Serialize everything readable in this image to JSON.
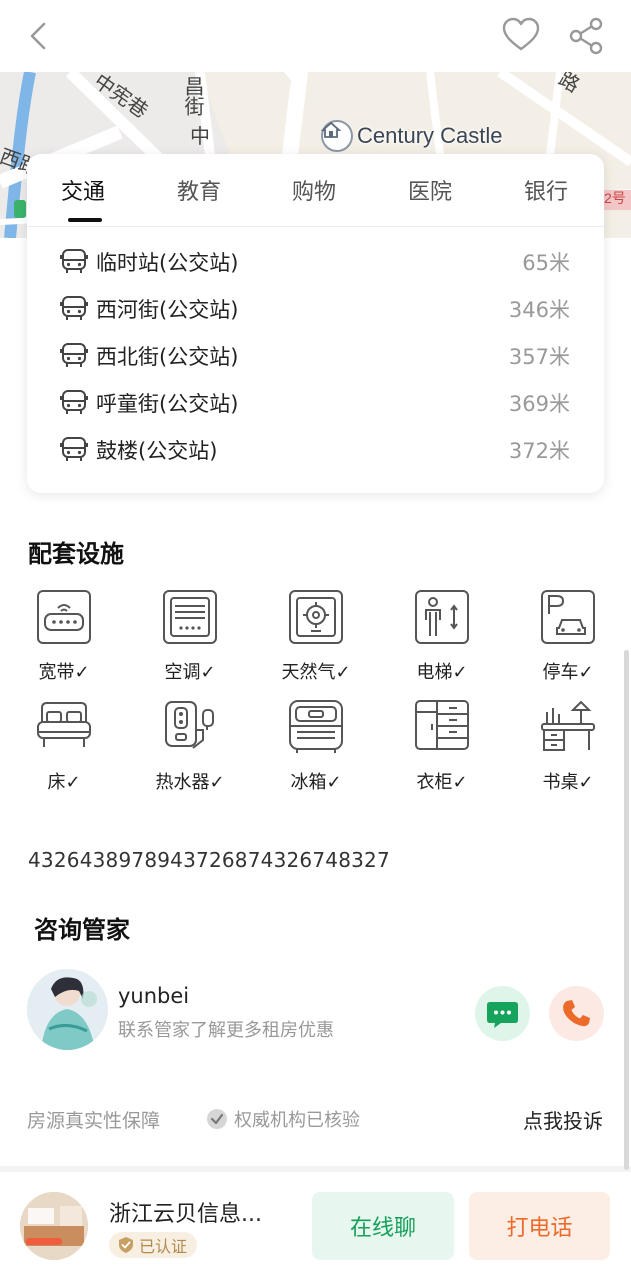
{
  "header": {
    "back_icon": "chevron-left-icon",
    "favorite_icon": "heart-outline-icon",
    "share_icon": "share-icon"
  },
  "map": {
    "labels": [
      "中宪巷",
      "昌街",
      "中",
      "西路",
      "路",
      "2号"
    ],
    "poi_name": "Century Castle",
    "poi_icon": "home-pin-icon"
  },
  "nearby": {
    "tabs": [
      "交通",
      "教育",
      "购物",
      "医院",
      "银行"
    ],
    "active_tab": "交通",
    "stops": [
      {
        "name": "临时站(公交站)",
        "distance": "65米"
      },
      {
        "name": "西河街(公交站)",
        "distance": "346米"
      },
      {
        "name": "西北街(公交站)",
        "distance": "357米"
      },
      {
        "name": "呼童街(公交站)",
        "distance": "369米"
      },
      {
        "name": "鼓楼(公交站)",
        "distance": "372米"
      }
    ]
  },
  "facilities": {
    "title": "配套设施",
    "items": [
      {
        "label": "宽带✓",
        "icon": "router-icon"
      },
      {
        "label": "空调✓",
        "icon": "air-conditioner-icon"
      },
      {
        "label": "天然气✓",
        "icon": "gas-icon"
      },
      {
        "label": "电梯✓",
        "icon": "elevator-icon"
      },
      {
        "label": "停车✓",
        "icon": "parking-icon"
      },
      {
        "label": "床✓",
        "icon": "bed-icon"
      },
      {
        "label": "热水器✓",
        "icon": "water-heater-icon"
      },
      {
        "label": "冰箱✓",
        "icon": "fridge-icon"
      },
      {
        "label": "衣柜✓",
        "icon": "wardrobe-icon"
      },
      {
        "label": "书桌✓",
        "icon": "desk-icon"
      }
    ]
  },
  "description": "4326438978943726874326748327",
  "agent": {
    "section_title": "咨询管家",
    "name": "yunbei",
    "subtitle": "联系管家了解更多租房优惠",
    "chat_icon": "chat-bubble-icon",
    "phone_icon": "phone-icon"
  },
  "guarantee": {
    "label": "房源真实性保障",
    "verified": "权威机构已核验",
    "complaint": "点我投诉"
  },
  "bottom": {
    "company": "浙江云贝信息...",
    "cert_badge": "已认证",
    "chat_button": "在线聊",
    "call_button": "打电话"
  },
  "colors": {
    "green": "#15a05a",
    "orange": "#ec6a2a",
    "gold": "#b38a4c"
  }
}
